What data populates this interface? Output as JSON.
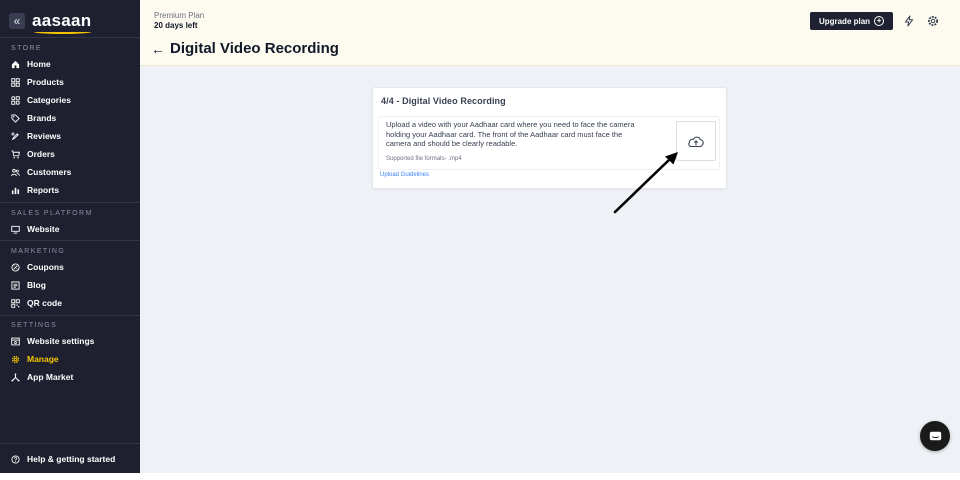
{
  "sidebar": {
    "logo": "aasaan",
    "collapse_icon": "double-chevron-left-icon",
    "sections": [
      {
        "title": "STORE",
        "items": [
          {
            "label": "Home",
            "icon": "home-icon"
          },
          {
            "label": "Products",
            "icon": "products-icon"
          },
          {
            "label": "Categories",
            "icon": "categories-icon"
          },
          {
            "label": "Brands",
            "icon": "tag-icon"
          },
          {
            "label": "Reviews",
            "icon": "reviews-icon"
          },
          {
            "label": "Orders",
            "icon": "cart-icon"
          },
          {
            "label": "Customers",
            "icon": "customers-icon"
          },
          {
            "label": "Reports",
            "icon": "reports-icon"
          }
        ]
      },
      {
        "title": "SALES PLATFORM",
        "items": [
          {
            "label": "Website",
            "icon": "monitor-icon"
          }
        ]
      },
      {
        "title": "MARKETING",
        "items": [
          {
            "label": "Coupons",
            "icon": "coupon-icon"
          },
          {
            "label": "Blog",
            "icon": "blog-icon"
          },
          {
            "label": "QR code",
            "icon": "qr-code-icon"
          }
        ]
      },
      {
        "title": "SETTINGS",
        "items": [
          {
            "label": "Website settings",
            "icon": "website-settings-icon"
          },
          {
            "label": "Manage",
            "icon": "gear-icon",
            "active": true
          },
          {
            "label": "App Market",
            "icon": "app-market-icon"
          }
        ]
      }
    ],
    "help": {
      "label": "Help & getting started",
      "icon": "help-icon"
    }
  },
  "topbar": {
    "plan_name": "Premium Plan",
    "plan_days": "20 days left",
    "upgrade_label": "Upgrade plan",
    "icons": [
      "lightning-icon",
      "gear-icon"
    ]
  },
  "page": {
    "title": "Digital Video Recording"
  },
  "card": {
    "title": "4/4 - Digital Video Recording",
    "instructions": "Upload a video with your Aadhaar card where you need to face the camera holding your Aadhaar card. The front of the Aadhaar card must face the camera and should be clearly readable.",
    "formats": "Supported file formats- .mp4",
    "upload_icon": "cloud-upload-icon",
    "guidelines_link": "Upload Guidelines"
  },
  "colors": {
    "sidebar_bg": "#1e2030",
    "active": "#f5c400",
    "topbar_bg": "#fdfaf0",
    "main_bg": "#eef1f5",
    "link": "#3b82f6"
  }
}
